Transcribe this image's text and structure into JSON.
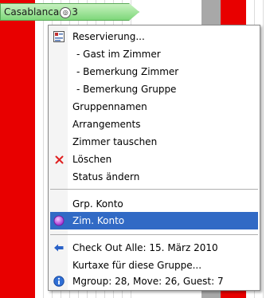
{
  "reservation": {
    "name": "Casablanca",
    "count": "3"
  },
  "menu": {
    "items": [
      {
        "label": "Reservierung...",
        "icon": "reservation-icon"
      },
      {
        "label": "- Gast im Zimmer"
      },
      {
        "label": "- Bemerkung Zimmer"
      },
      {
        "label": "- Bemerkung Gruppe"
      },
      {
        "label": "Gruppennamen"
      },
      {
        "label": "Arrangements"
      },
      {
        "label": "Zimmer tauschen"
      },
      {
        "label": "Löschen",
        "icon": "delete-x-icon"
      },
      {
        "label": "Status ändern"
      },
      {
        "label": "Grp. Konto"
      },
      {
        "label": "Zim. Konto",
        "icon": "account-circle-icon"
      },
      {
        "label": "Check Out Alle:  15. März 2010",
        "icon": "arrow-left-icon"
      },
      {
        "label": "Kurtaxe für diese Gruppe..."
      },
      {
        "label": "Mgroup: 28, Move: 26, Guest: 7",
        "icon": "info-icon"
      }
    ],
    "selected_item": "Zim. Konto"
  },
  "colors": {
    "selection": "#316ac5",
    "occupied_column": "#e80000",
    "blocked_column": "#a8a8a8",
    "reservation_bar": "#7ed77a"
  }
}
